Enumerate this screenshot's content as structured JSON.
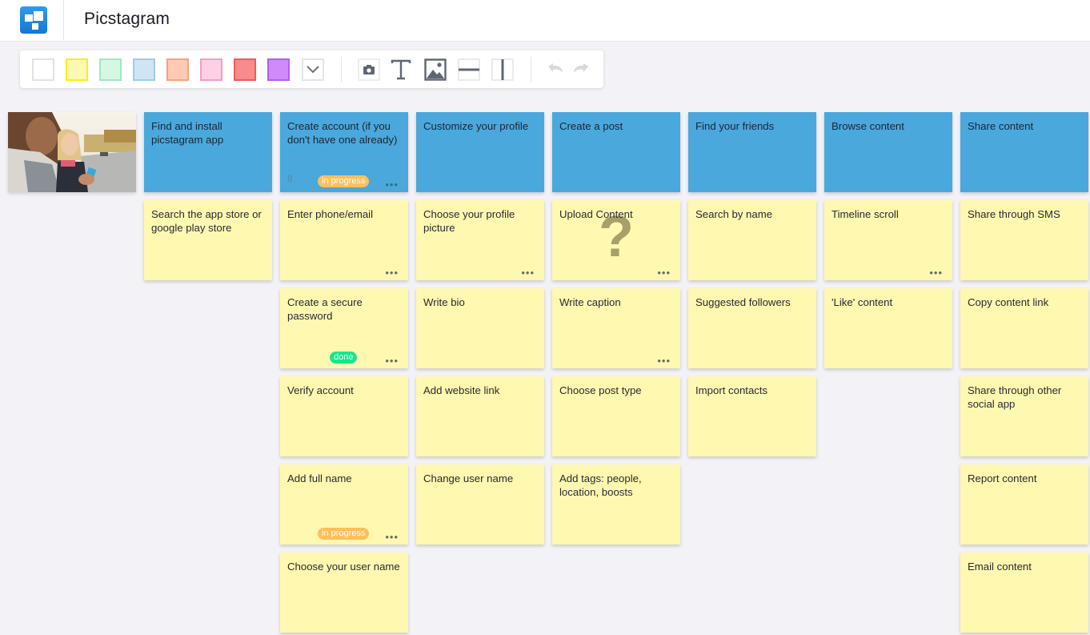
{
  "app": {
    "title": "Picstagram",
    "logo_icon": "board-logo-icon"
  },
  "toolbar": {
    "swatches": [
      {
        "name": "white",
        "fill": "#ffffff",
        "border": "#e2e2e2"
      },
      {
        "name": "yellow",
        "fill": "#fff8b0",
        "border": "#ffeb1a"
      },
      {
        "name": "green",
        "fill": "#d4f8e4",
        "border": "#9fe8bf"
      },
      {
        "name": "blue",
        "fill": "#cfe5f3",
        "border": "#9fcbe6"
      },
      {
        "name": "orange",
        "fill": "#ffcab3",
        "border": "#f8a37c"
      },
      {
        "name": "pink",
        "fill": "#ffcfe6",
        "border": "#f79bc6"
      },
      {
        "name": "red",
        "fill": "#f88b8b",
        "border": "#ef5a5a"
      },
      {
        "name": "purple",
        "fill": "#cf8cf8",
        "border": "#b35ef0"
      }
    ],
    "more_colors_icon": "chevron-down-icon",
    "tools": [
      {
        "name": "camera",
        "icon": "camera-icon"
      },
      {
        "name": "text",
        "icon": "text-icon"
      },
      {
        "name": "image",
        "icon": "image-icon"
      },
      {
        "name": "horizontal-divider",
        "icon": "horizontal-divider-icon"
      },
      {
        "name": "vertical-divider",
        "icon": "vertical-divider-icon"
      }
    ],
    "undo_icon": "undo-icon",
    "redo_icon": "redo-icon"
  },
  "board": {
    "photo_alt": "Two women looking at a phone",
    "columns": [
      {
        "header": {
          "text": "Find and install picstagram app"
        },
        "cards": [
          {
            "text": "Search the app store or google play store"
          }
        ]
      },
      {
        "header": {
          "text": "Create account (if you don't have one already)",
          "count": "8",
          "badge": "in progress",
          "badge_type": "progress",
          "menu": true
        },
        "cards": [
          {
            "text": "Enter phone/email",
            "menu": true
          },
          {
            "text": "Create a secure password",
            "badge": "done",
            "badge_type": "done",
            "menu": true
          },
          {
            "text": "Verify account"
          },
          {
            "text": "Add full name",
            "badge": "in progress",
            "badge_type": "progress",
            "menu": true
          },
          {
            "text": "Choose your user name"
          }
        ]
      },
      {
        "header": {
          "text": "Customize your profile"
        },
        "cards": [
          {
            "text": "Choose your profile picture",
            "menu": true
          },
          {
            "text": "Write bio"
          },
          {
            "text": "Add website link"
          },
          {
            "text": "Change user name"
          }
        ]
      },
      {
        "header": {
          "text": "Create a post"
        },
        "cards": [
          {
            "text": "Upload Content",
            "menu": true,
            "question": "?"
          },
          {
            "text": "Write caption",
            "menu": true
          },
          {
            "text": "Choose post type"
          },
          {
            "text": "Add tags: people, location, boosts"
          }
        ]
      },
      {
        "header": {
          "text": "Find your friends"
        },
        "cards": [
          {
            "text": "Search by name"
          },
          {
            "text": "Suggested followers"
          },
          {
            "text": "Import contacts"
          }
        ]
      },
      {
        "header": {
          "text": "Browse content"
        },
        "cards": [
          {
            "text": "Timeline scroll",
            "menu": true
          },
          {
            "text": "'Like' content"
          }
        ]
      },
      {
        "header": {
          "text": "Share content"
        },
        "cards": [
          {
            "text": "Share through SMS"
          },
          {
            "text": "Copy content link"
          },
          {
            "text": "Share through other social app"
          },
          {
            "text": "Report content"
          },
          {
            "text": "Email content"
          }
        ]
      }
    ],
    "menu_glyph": "•••"
  }
}
